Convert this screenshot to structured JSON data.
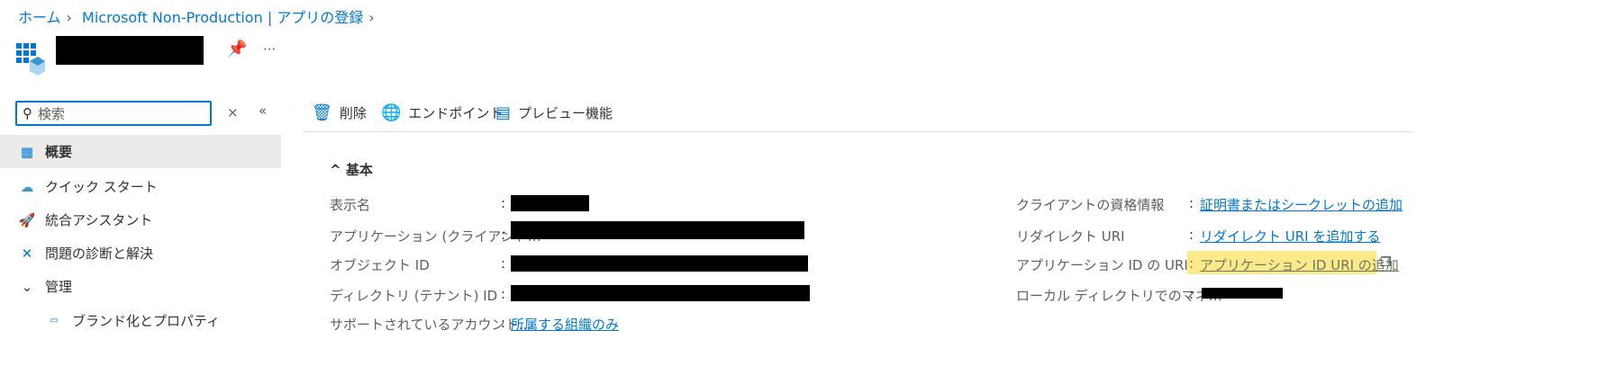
{
  "breadcrumb": [
    "ホーム",
    "Microsoft Non-Production | アプリの登録"
  ],
  "header": {
    "more": "···"
  },
  "sidebar": {
    "search_placeholder": "検索",
    "items": [
      {
        "label": "概要",
        "icon": "app-grid-icon",
        "selected": true
      },
      {
        "label": "クイック スタート",
        "icon": "cloud-icon"
      },
      {
        "label": "統合アシスタント",
        "icon": "rocket-icon"
      },
      {
        "label": "問題の診断と解決",
        "icon": "wrench-icon"
      },
      {
        "label": "管理",
        "icon": "chevron-down-icon"
      },
      {
        "label": "ブランド化とプロパティ",
        "icon": "www-icon"
      }
    ]
  },
  "toolbar": {
    "delete": "削除",
    "endpoints": "エンドポイント",
    "preview": "プレビュー機能"
  },
  "essentials": {
    "title": "基本",
    "left": [
      {
        "label": "表示名"
      },
      {
        "label": "アプリケーション (クライアント…"
      },
      {
        "label": "オブジェクト ID"
      },
      {
        "label": "ディレクトリ (テナント) ID"
      },
      {
        "label": "サポートされているアカウント…",
        "value": "所属する組織のみ"
      }
    ],
    "right": [
      {
        "label": "クライアントの資格情報",
        "value": "証明書またはシークレットの追加"
      },
      {
        "label": "リダイレクト URI",
        "value": "リダイレクト URI を追加する"
      },
      {
        "label": "アプリケーション ID の URI",
        "value": "アプリケーション ID URI の追加"
      },
      {
        "label": "ローカル ディレクトリでのマネ…"
      }
    ]
  },
  "colors": {
    "accent": "#0078d4",
    "highlight": "#fce100"
  }
}
